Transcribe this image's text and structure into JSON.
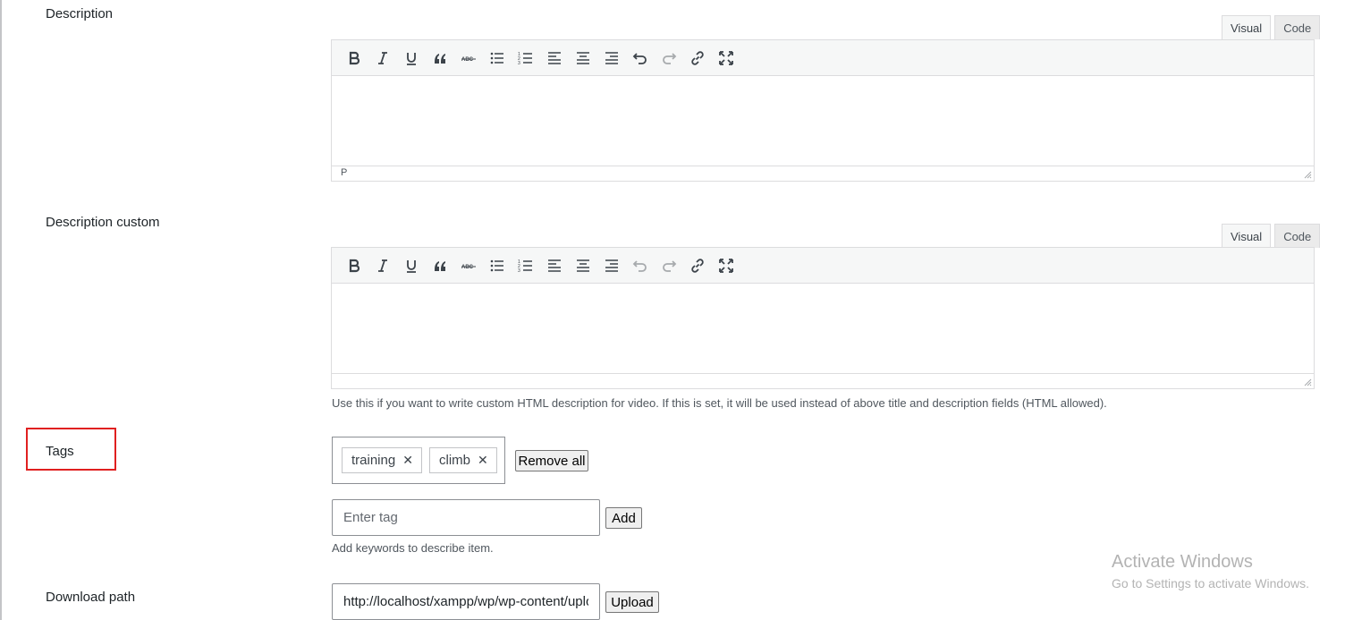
{
  "description_section": {
    "label": "Description",
    "tabs": [
      "Visual",
      "Code"
    ],
    "status_path": "P"
  },
  "description_custom_section": {
    "label": "Description custom",
    "tabs": [
      "Visual",
      "Code"
    ],
    "hint": "Use this if you want to write custom HTML description for video. If this is set, it will be used instead of above title and description fields (HTML allowed)."
  },
  "toolbar_icons": [
    "bold-icon",
    "italic-icon",
    "underline-icon",
    "blockquote-icon",
    "strikethrough-icon",
    "bullet-list-icon",
    "numbered-list-icon",
    "align-left-icon",
    "align-center-icon",
    "align-right-icon",
    "undo-icon",
    "redo-icon",
    "link-icon",
    "fullscreen-icon"
  ],
  "tags_section": {
    "label": "Tags",
    "tags": [
      "training",
      "climb"
    ],
    "remove_all_label": "Remove all",
    "input_placeholder": "Enter tag",
    "add_label": "Add",
    "hint": "Add keywords to describe item."
  },
  "download_section": {
    "label": "Download path",
    "value": "http://localhost/xampp/wp/wp-content/uploads/",
    "upload_label": "Upload"
  },
  "watermark": {
    "title": "Activate Windows",
    "subtitle": "Go to Settings to activate Windows."
  }
}
